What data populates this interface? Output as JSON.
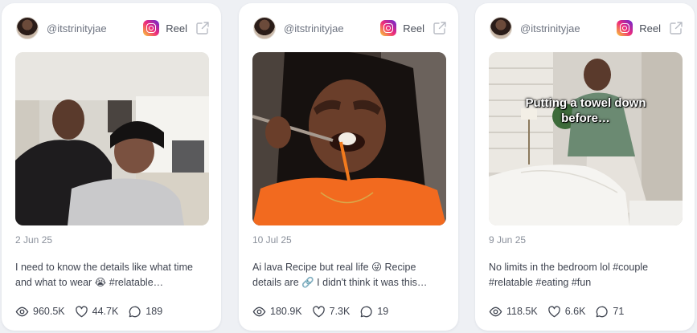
{
  "cards": [
    {
      "username": "@itstrinityjae",
      "type_label": "Reel",
      "date": "2 Jun 25",
      "caption": "I need to know the details like what time and what to wear 😭 #relatable…",
      "overlay": "",
      "views": "960.5K",
      "likes": "44.7K",
      "comments": "189"
    },
    {
      "username": "@itstrinityjae",
      "type_label": "Reel",
      "date": "10 Jul 25",
      "caption": "Ai lava Recipe but real life 😜 Recipe details are 🔗 I didn't think it was this…",
      "overlay": "",
      "views": "180.9K",
      "likes": "7.3K",
      "comments": "19"
    },
    {
      "username": "@itstrinityjae",
      "type_label": "Reel",
      "date": "9 Jun 25",
      "caption": "No limits in the bedroom lol #couple #relatable #eating #fun",
      "overlay": "Putting a towel down before…",
      "views": "118.5K",
      "likes": "6.6K",
      "comments": "71"
    }
  ],
  "icons": {
    "platform": "instagram-icon",
    "open_external": "external-link-icon",
    "views": "eye-icon",
    "likes": "heart-icon",
    "comments": "comment-icon"
  },
  "colors": {
    "background": "#eef0f4",
    "card": "#ffffff",
    "muted_text": "#8a909b",
    "body_text": "#3f4450"
  }
}
